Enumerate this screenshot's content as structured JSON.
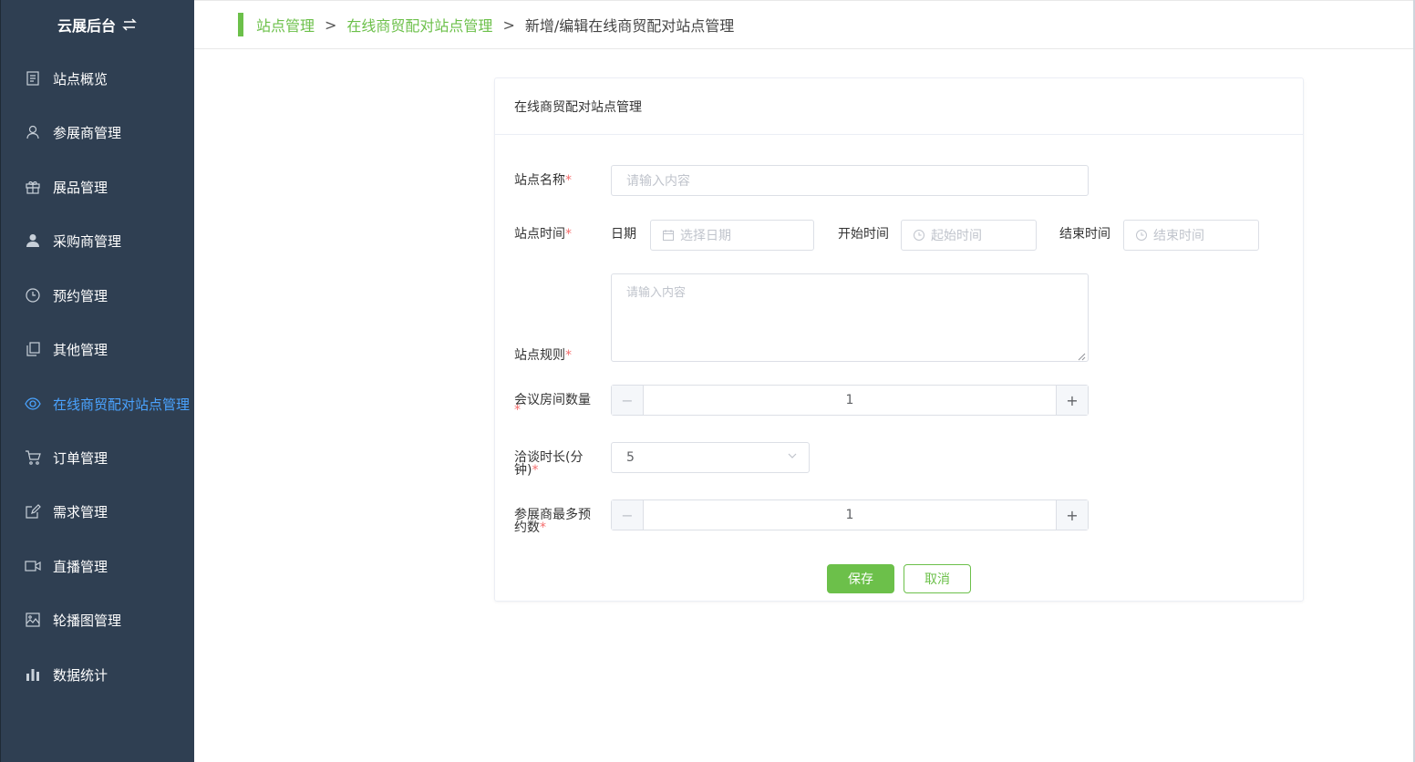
{
  "sidebar": {
    "brand": "云展后台",
    "items": [
      {
        "label": "站点概览",
        "icon": "document-icon"
      },
      {
        "label": "参展商管理",
        "icon": "user-icon"
      },
      {
        "label": "展品管理",
        "icon": "gift-icon"
      },
      {
        "label": "采购商管理",
        "icon": "person-filled-icon"
      },
      {
        "label": "预约管理",
        "icon": "clock-icon"
      },
      {
        "label": "其他管理",
        "icon": "copy-icon"
      },
      {
        "label": "在线商贸配对站点管理",
        "icon": "eye-icon",
        "active": true
      },
      {
        "label": "订单管理",
        "icon": "cart-icon"
      },
      {
        "label": "需求管理",
        "icon": "edit-icon"
      },
      {
        "label": "直播管理",
        "icon": "video-icon"
      },
      {
        "label": "轮播图管理",
        "icon": "picture-icon"
      },
      {
        "label": "数据统计",
        "icon": "bar-chart-icon"
      }
    ],
    "active_color": "#4aa3ff",
    "background": "#2f3f52"
  },
  "breadcrumb": {
    "items": [
      "站点管理",
      "在线商贸配对站点管理"
    ],
    "separator": ">",
    "current": "新增/编辑在线商贸配对站点管理",
    "accent": "#6cc04a"
  },
  "form": {
    "title": "在线商贸配对站点管理",
    "required_mark": "*",
    "site_name": {
      "label": "站点名称",
      "placeholder": "请输入内容"
    },
    "site_time": {
      "label": "站点时间",
      "date_label": "日期",
      "date_placeholder": "选择日期",
      "start_label": "开始时间",
      "start_placeholder": "起始时间",
      "end_label": "结束时间",
      "end_placeholder": "结束时间"
    },
    "site_rules": {
      "label": "站点规则",
      "placeholder": "请输入内容"
    },
    "room_count": {
      "label": "会议房间数量",
      "value": "1",
      "minus": "−",
      "plus": "+"
    },
    "duration": {
      "label_line1": "洽谈时长(分",
      "label_line2": "钟)",
      "value": "5"
    },
    "max_booking": {
      "label_line1": "参展商最多预",
      "label_line2": "约数",
      "value": "1",
      "minus": "−",
      "plus": "+"
    },
    "save_label": "保存",
    "cancel_label": "取消"
  }
}
